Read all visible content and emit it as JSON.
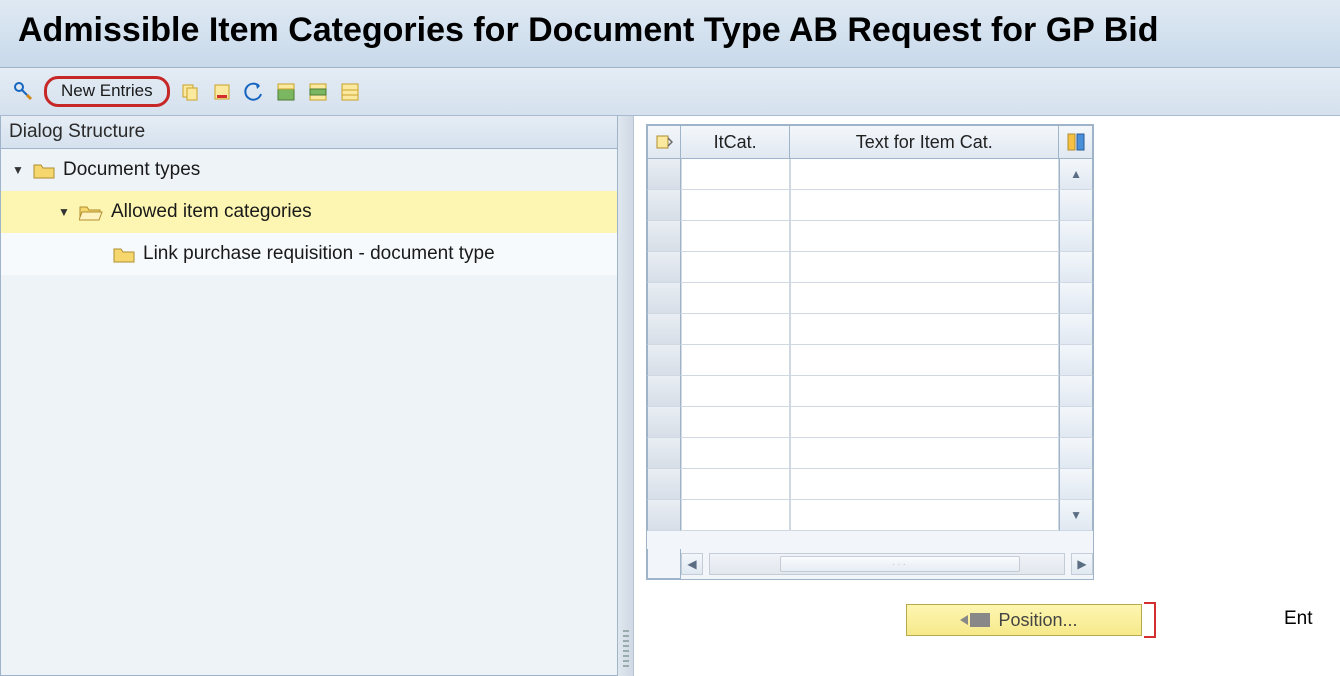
{
  "title": "Admissible Item Categories for Document Type AB Request for GP Bid",
  "toolbar": {
    "new_entries_label": "New Entries"
  },
  "dialog_structure": {
    "header": "Dialog Structure",
    "nodes": {
      "root": {
        "label": "Document types"
      },
      "allowed": {
        "label": "Allowed item categories"
      },
      "link": {
        "label": "Link purchase requisition - document type"
      }
    }
  },
  "table": {
    "columns": {
      "itcat": "ItCat.",
      "textcat": "Text for Item Cat."
    },
    "rows_visible": 12
  },
  "position_button": "Position...",
  "footer_fragment": "Ent"
}
